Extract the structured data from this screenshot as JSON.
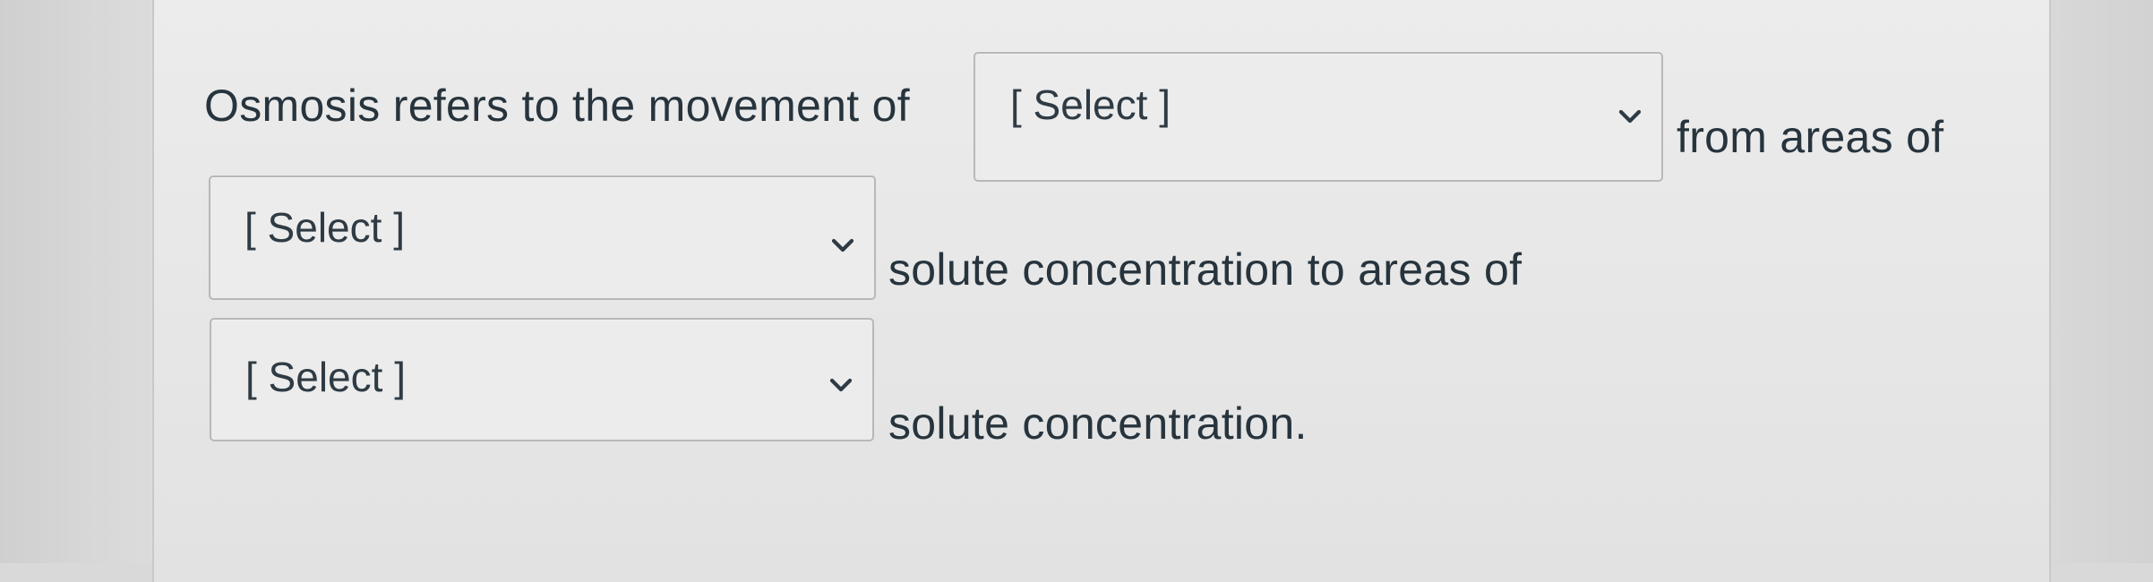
{
  "question": {
    "part1": "Osmosis refers to the movement of",
    "part2": "from areas of",
    "part3": "solute concentration to areas of",
    "part4": "solute concentration."
  },
  "selects": [
    {
      "selected": "[ Select ]",
      "icon": "chevron-down-icon"
    },
    {
      "selected": "[ Select ]",
      "icon": "chevron-down-icon"
    },
    {
      "selected": "[ Select ]",
      "icon": "chevron-down-icon"
    }
  ],
  "colors": {
    "text": "#27343d",
    "border": "#b8b8b8",
    "background": "#e8e8e8"
  }
}
